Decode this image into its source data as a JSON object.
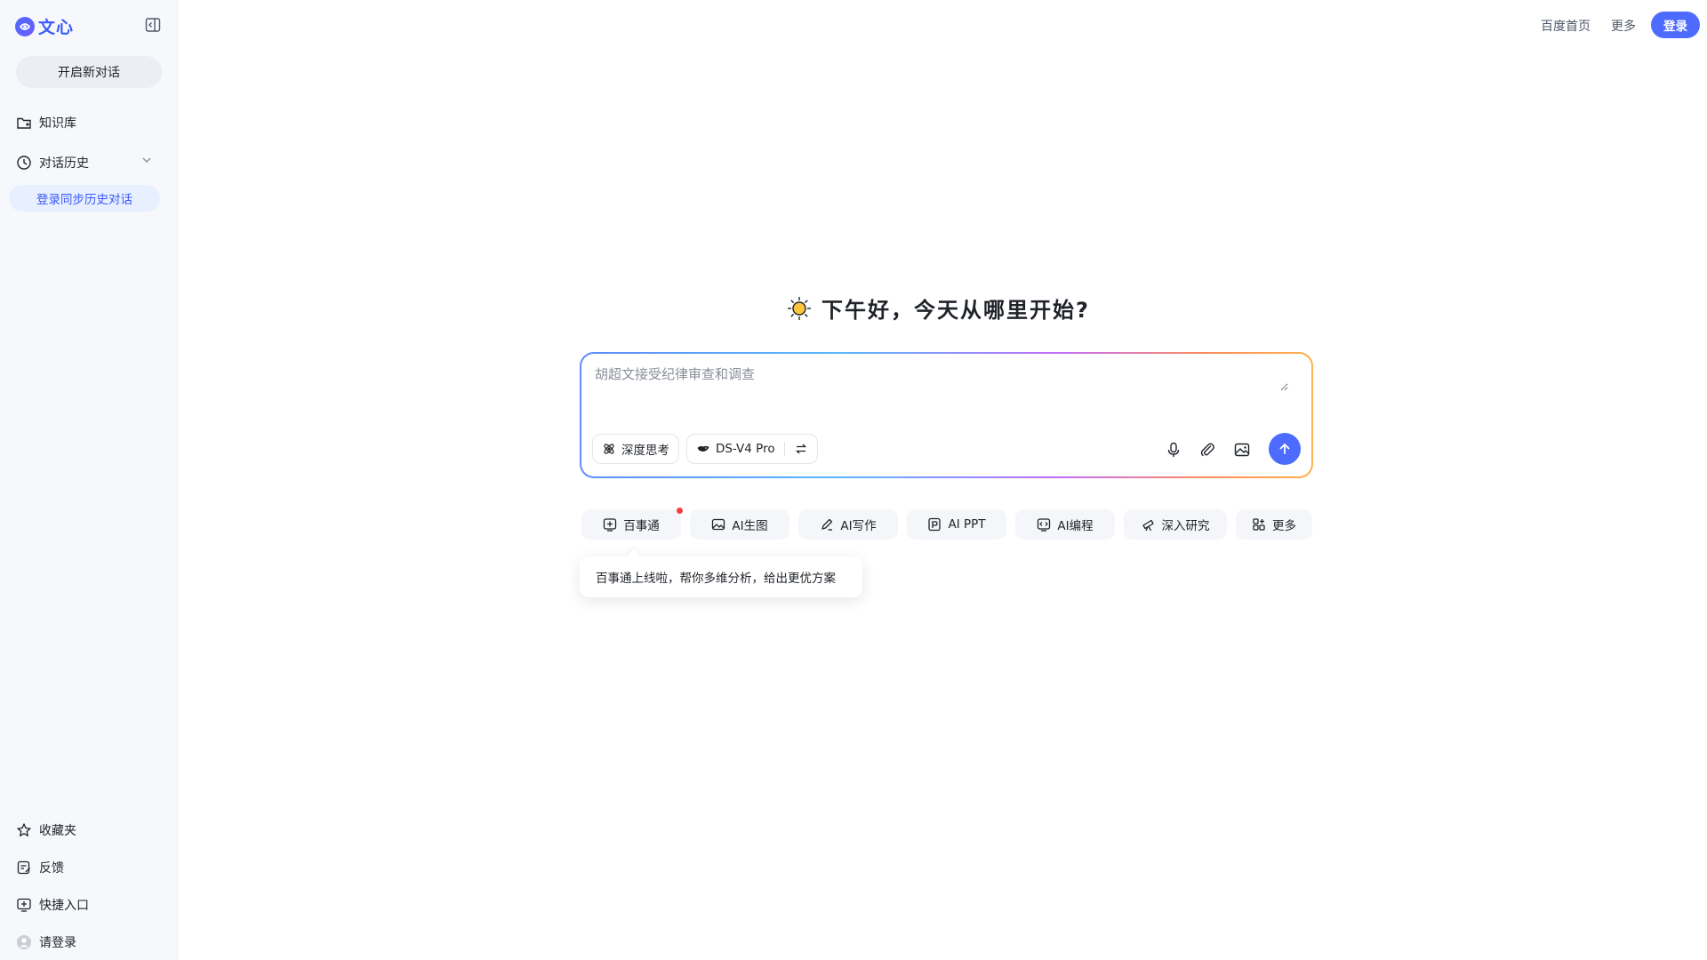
{
  "app": {
    "logo_text": "文心",
    "brand_color": "#4d6bfe"
  },
  "sidebar": {
    "new_chat_label": "开启新对话",
    "knowledge_label": "知识库",
    "history_label": "对话历史",
    "login_sync_label": "登录同步历史对话",
    "bottom_items": [
      {
        "label": "收藏夹",
        "icon": "star-icon"
      },
      {
        "label": "反馈",
        "icon": "feedback-icon"
      },
      {
        "label": "快捷入口",
        "icon": "shortcut-icon"
      },
      {
        "label": "请登录",
        "icon": "user-avatar-icon"
      }
    ]
  },
  "topbar": {
    "baidu_home": "百度首页",
    "more": "更多",
    "login": "登录"
  },
  "greeting": {
    "text": "下午好，今天从哪里开始?"
  },
  "input": {
    "placeholder": "胡超文接受纪律审查和调查",
    "deep_think_label": "深度思考",
    "model_label": "DS-V4 Pro"
  },
  "chips": [
    {
      "label": "百事通",
      "icon": "plus-square-icon"
    },
    {
      "label": "AI生图",
      "icon": "image-icon"
    },
    {
      "label": "AI写作",
      "icon": "pen-icon"
    },
    {
      "label": "AI PPT",
      "icon": "ppt-icon"
    },
    {
      "label": "AI编程",
      "icon": "code-icon"
    },
    {
      "label": "深入研究",
      "icon": "telescope-icon"
    },
    {
      "label": "更多",
      "icon": "apps-icon"
    }
  ],
  "tooltip": {
    "text": "百事通上线啦，帮你多维分析，给出更优方案"
  }
}
